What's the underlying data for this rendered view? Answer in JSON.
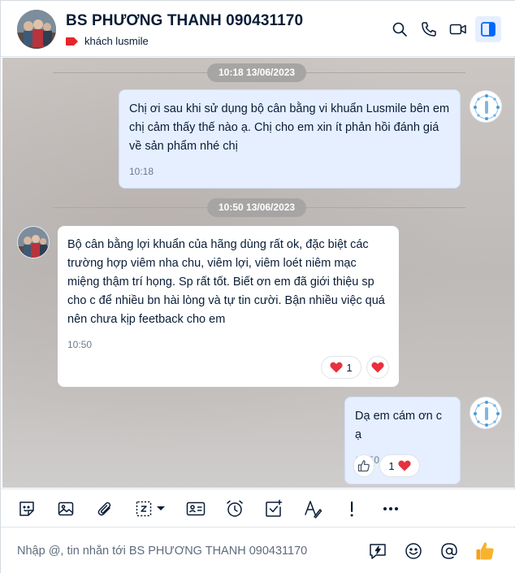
{
  "header": {
    "title": "BS PHƯƠNG THANH  090431170",
    "tag": "khách lusmile",
    "tag_color": "#e5252a",
    "icons": [
      "search-icon",
      "phone-icon",
      "video-call-icon",
      "sidebar-toggle-icon"
    ]
  },
  "conversation": {
    "dividers": [
      {
        "label": "10:18 13/06/2023"
      },
      {
        "label": "10:50 13/06/2023"
      }
    ],
    "messages": [
      {
        "sender": "me",
        "text": "Chị ơi sau khi sử dụng bộ cân bằng vi khuẩn Lusmile bên em chị cảm thấy thế nào ạ. Chị cho em xin ít phản hồi đánh giá về sản phẩm nhé chị",
        "time": "10:18"
      },
      {
        "sender": "them",
        "text": "Bộ cân bằng lợi khuẩn của hãng dùng rất ok, đặc biệt các trường hợp viêm nha chu, viêm lợi, viêm loét niêm mạc miệng thậm trí họng. Sp rất tốt. Biết ơn em đã giới thiệu sp cho c để nhiều bn hài lòng và tự tin cười. Bận nhiều việc quá nên chưa kịp feetback cho em",
        "time": "10:50",
        "reaction_count": "1"
      },
      {
        "sender": "me",
        "text": "Dạ em cám ơn c ạ",
        "time": "10:50",
        "reaction_count": "1"
      }
    ]
  },
  "toolbar": {
    "items": [
      "sticker-icon",
      "image-icon",
      "attachment-icon",
      "screenshot-icon",
      "business-card-icon",
      "reminder-icon",
      "task-icon",
      "text-format-icon",
      "urgent-icon",
      "more-icon"
    ]
  },
  "composer": {
    "placeholder": "Nhập @, tin nhắn tới BS PHƯƠNG THANH 090431170",
    "value": ""
  },
  "colors": {
    "accent": "#0068ff",
    "my_bubble": "#e5efff",
    "heart": "#e8303e"
  }
}
